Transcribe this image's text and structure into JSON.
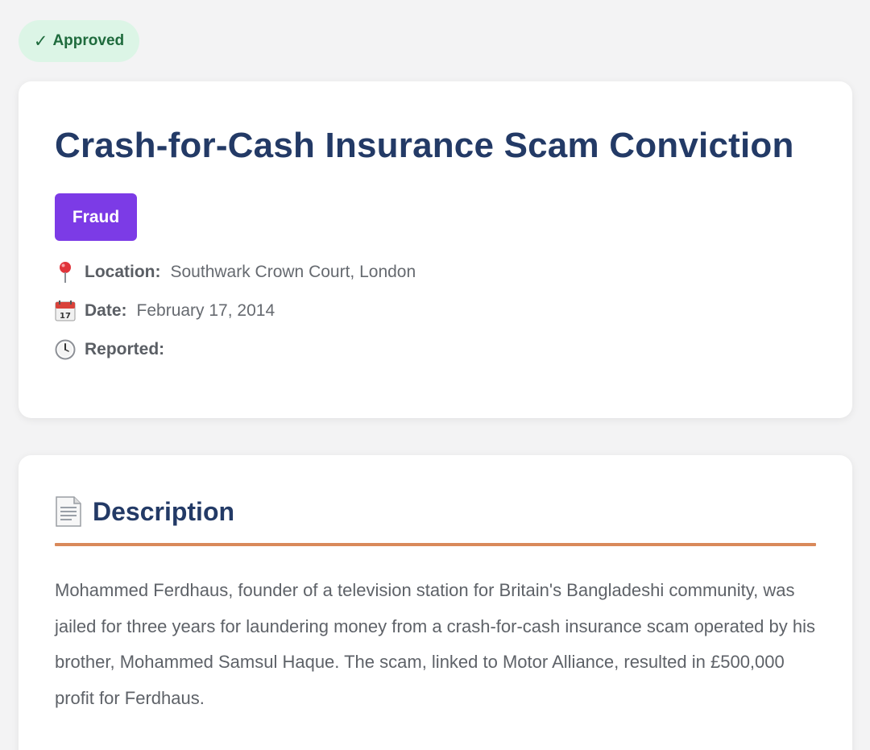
{
  "status": {
    "check": "✓",
    "label": "Approved"
  },
  "incident": {
    "title": "Crash-for-Cash Insurance Scam Conviction",
    "category": "Fraud",
    "location_label": "Location:",
    "location_value": "Southwark Crown Court, London",
    "date_label": "Date:",
    "date_value": "February 17, 2014",
    "reported_label": "Reported:",
    "reported_value": ""
  },
  "description": {
    "heading": "Description",
    "text": "Mohammed Ferdhaus, founder of a television station for Britain's Bangladeshi community, was jailed for three years for laundering money from a crash-for-cash insurance scam operated by his brother, Mohammed Samsul Haque. The scam, linked to Motor Alliance, resulted in £500,000 profit for Ferdhaus."
  },
  "icons": {
    "status": "check-icon",
    "location": "map-pin-icon",
    "date": "calendar-icon",
    "reported": "clock-icon",
    "description": "document-icon"
  },
  "colors": {
    "title": "#233a66",
    "category_badge": "#7c3be6",
    "approved_bg": "#dcf5e6",
    "approved_text": "#1f6b3d",
    "accent_rule": "#d9895a"
  }
}
